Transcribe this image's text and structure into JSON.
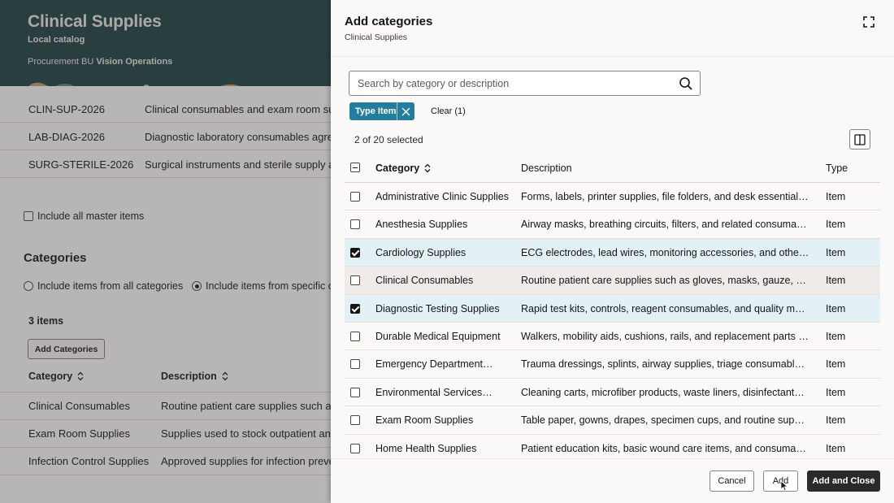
{
  "background": {
    "header": {
      "title": "Clinical Supplies",
      "subtitle": "Local catalog",
      "bu_label": "Procurement BU",
      "bu_value": "Vision Operations",
      "bg_color": "#2f4f50"
    },
    "agreements": [
      {
        "code": "CLIN-SUP-2026",
        "description": "Clinical consumables and exam room supply"
      },
      {
        "code": "LAB-DIAG-2026",
        "description": "Diagnostic laboratory consumables agreeme"
      },
      {
        "code": "SURG-STERILE-2026",
        "description": "Surgical instruments and sterile supply agre"
      }
    ],
    "include_master_label": "Include all master items",
    "categories_heading": "Categories",
    "radio_all": "Include items from all categories",
    "radio_specific": "Include items from specific ca",
    "items_count": "3 items",
    "add_categories_button": "Add Categories",
    "columns": {
      "category": "Category",
      "description": "Description"
    },
    "rows": [
      {
        "category": "Clinical Consumables",
        "description": "Routine patient care supplies such as glo"
      },
      {
        "category": "Exam Room Supplies",
        "description": "Supplies used to stock outpatient and inp"
      },
      {
        "category": "Infection Control Supplies",
        "description": "Approved supplies for infection preventio"
      }
    ]
  },
  "drawer": {
    "title": "Add categories",
    "subtitle": "Clinical Supplies",
    "search_placeholder": "Search by category or description",
    "filter_chip": "Type Item",
    "clear_label": "Clear (1)",
    "selection_count": "2 of 20 selected",
    "columns": {
      "category": "Category",
      "description": "Description",
      "type": "Type"
    },
    "rows": [
      {
        "category": "Administrative Clinic Supplies",
        "description": "Forms, labels, printer supplies, file folders, and desk essentials us…",
        "type": "Item",
        "checked": false
      },
      {
        "category": "Anesthesia Supplies",
        "description": "Airway masks, breathing circuits, filters, and related consumables…",
        "type": "Item",
        "checked": false
      },
      {
        "category": "Cardiology Supplies",
        "description": "ECG electrodes, lead wires, monitoring accessories, and other…",
        "type": "Item",
        "checked": true
      },
      {
        "category": "Clinical Consumables",
        "description": "Routine patient care supplies such as gloves, masks, gauze, swabs…",
        "type": "Item",
        "checked": false
      },
      {
        "category": "Diagnostic Testing Supplies",
        "description": "Rapid test kits, controls, reagent consumables, and quality materi…",
        "type": "Item",
        "checked": true
      },
      {
        "category": "Durable Medical Equipment",
        "description": "Walkers, mobility aids, cushions, rails, and replacement parts used…",
        "type": "Item",
        "checked": false
      },
      {
        "category": "Emergency Department…",
        "description": "Trauma dressings, splints, airway supplies, triage consumables, a…",
        "type": "Item",
        "checked": false
      },
      {
        "category": "Environmental Services…",
        "description": "Cleaning carts, microfiber products, waste liners, disinfectants, an…",
        "type": "Item",
        "checked": false
      },
      {
        "category": "Exam Room Supplies",
        "description": "Table paper, gowns, drapes, specimen cups, and routine supplies…",
        "type": "Item",
        "checked": false
      },
      {
        "category": "Home Health Supplies",
        "description": "Patient education kits, basic wound care items, and consumables…",
        "type": "Item",
        "checked": false
      }
    ],
    "buttons": {
      "cancel": "Cancel",
      "add": "Add",
      "add_close": "Add and Close"
    },
    "chip_color": "#227e9e",
    "selected_row_color": "#e3f1f7"
  }
}
